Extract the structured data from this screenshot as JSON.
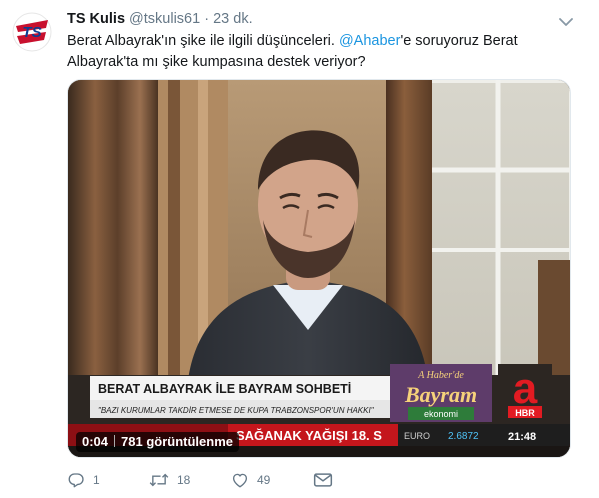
{
  "tweet": {
    "name": "TS Kulis",
    "handle": "@tskulis61",
    "separator": "·",
    "time": "23 dk.",
    "text_part1": "Berat Albayrak'ın şike ile ilgili düşünceleri. ",
    "mention": "@Ahaber",
    "text_part2": "'e soruyoruz Berat Albayrak'ta mı şike kumpasına destek veriyor?",
    "avatar_letters": "TS"
  },
  "video": {
    "duration": "0:04",
    "views": "781 görüntülenme",
    "lower_third_title": "BERAT ALBAYRAK İLE BAYRAM SOHBETİ",
    "lower_third_subtitle": "\"BAZI KURUMLAR TAKDİR ETMESE DE KUPA TRABZONSPOR'UN HAKKI\"",
    "ticker_text": "SAĞANAK YAĞIŞI 18. S",
    "ticker_market": "EURO",
    "ticker_value": "2.6872",
    "ticker_clock": "21:48",
    "logo_line1": "A Haber'de",
    "logo_line2": "Bayram",
    "logo_line3": "ekonomi",
    "channel_letter": "a",
    "channel_sub": "HBR"
  },
  "actions": {
    "replies": "1",
    "retweets": "18",
    "likes": "49"
  },
  "colors": {
    "link": "#1b95e0",
    "muted": "#657786",
    "ticker_red": "#c4161c"
  },
  "icons": [
    "ts-logo",
    "chevron-down-icon",
    "reply-icon",
    "retweet-icon",
    "like-icon",
    "message-icon"
  ]
}
